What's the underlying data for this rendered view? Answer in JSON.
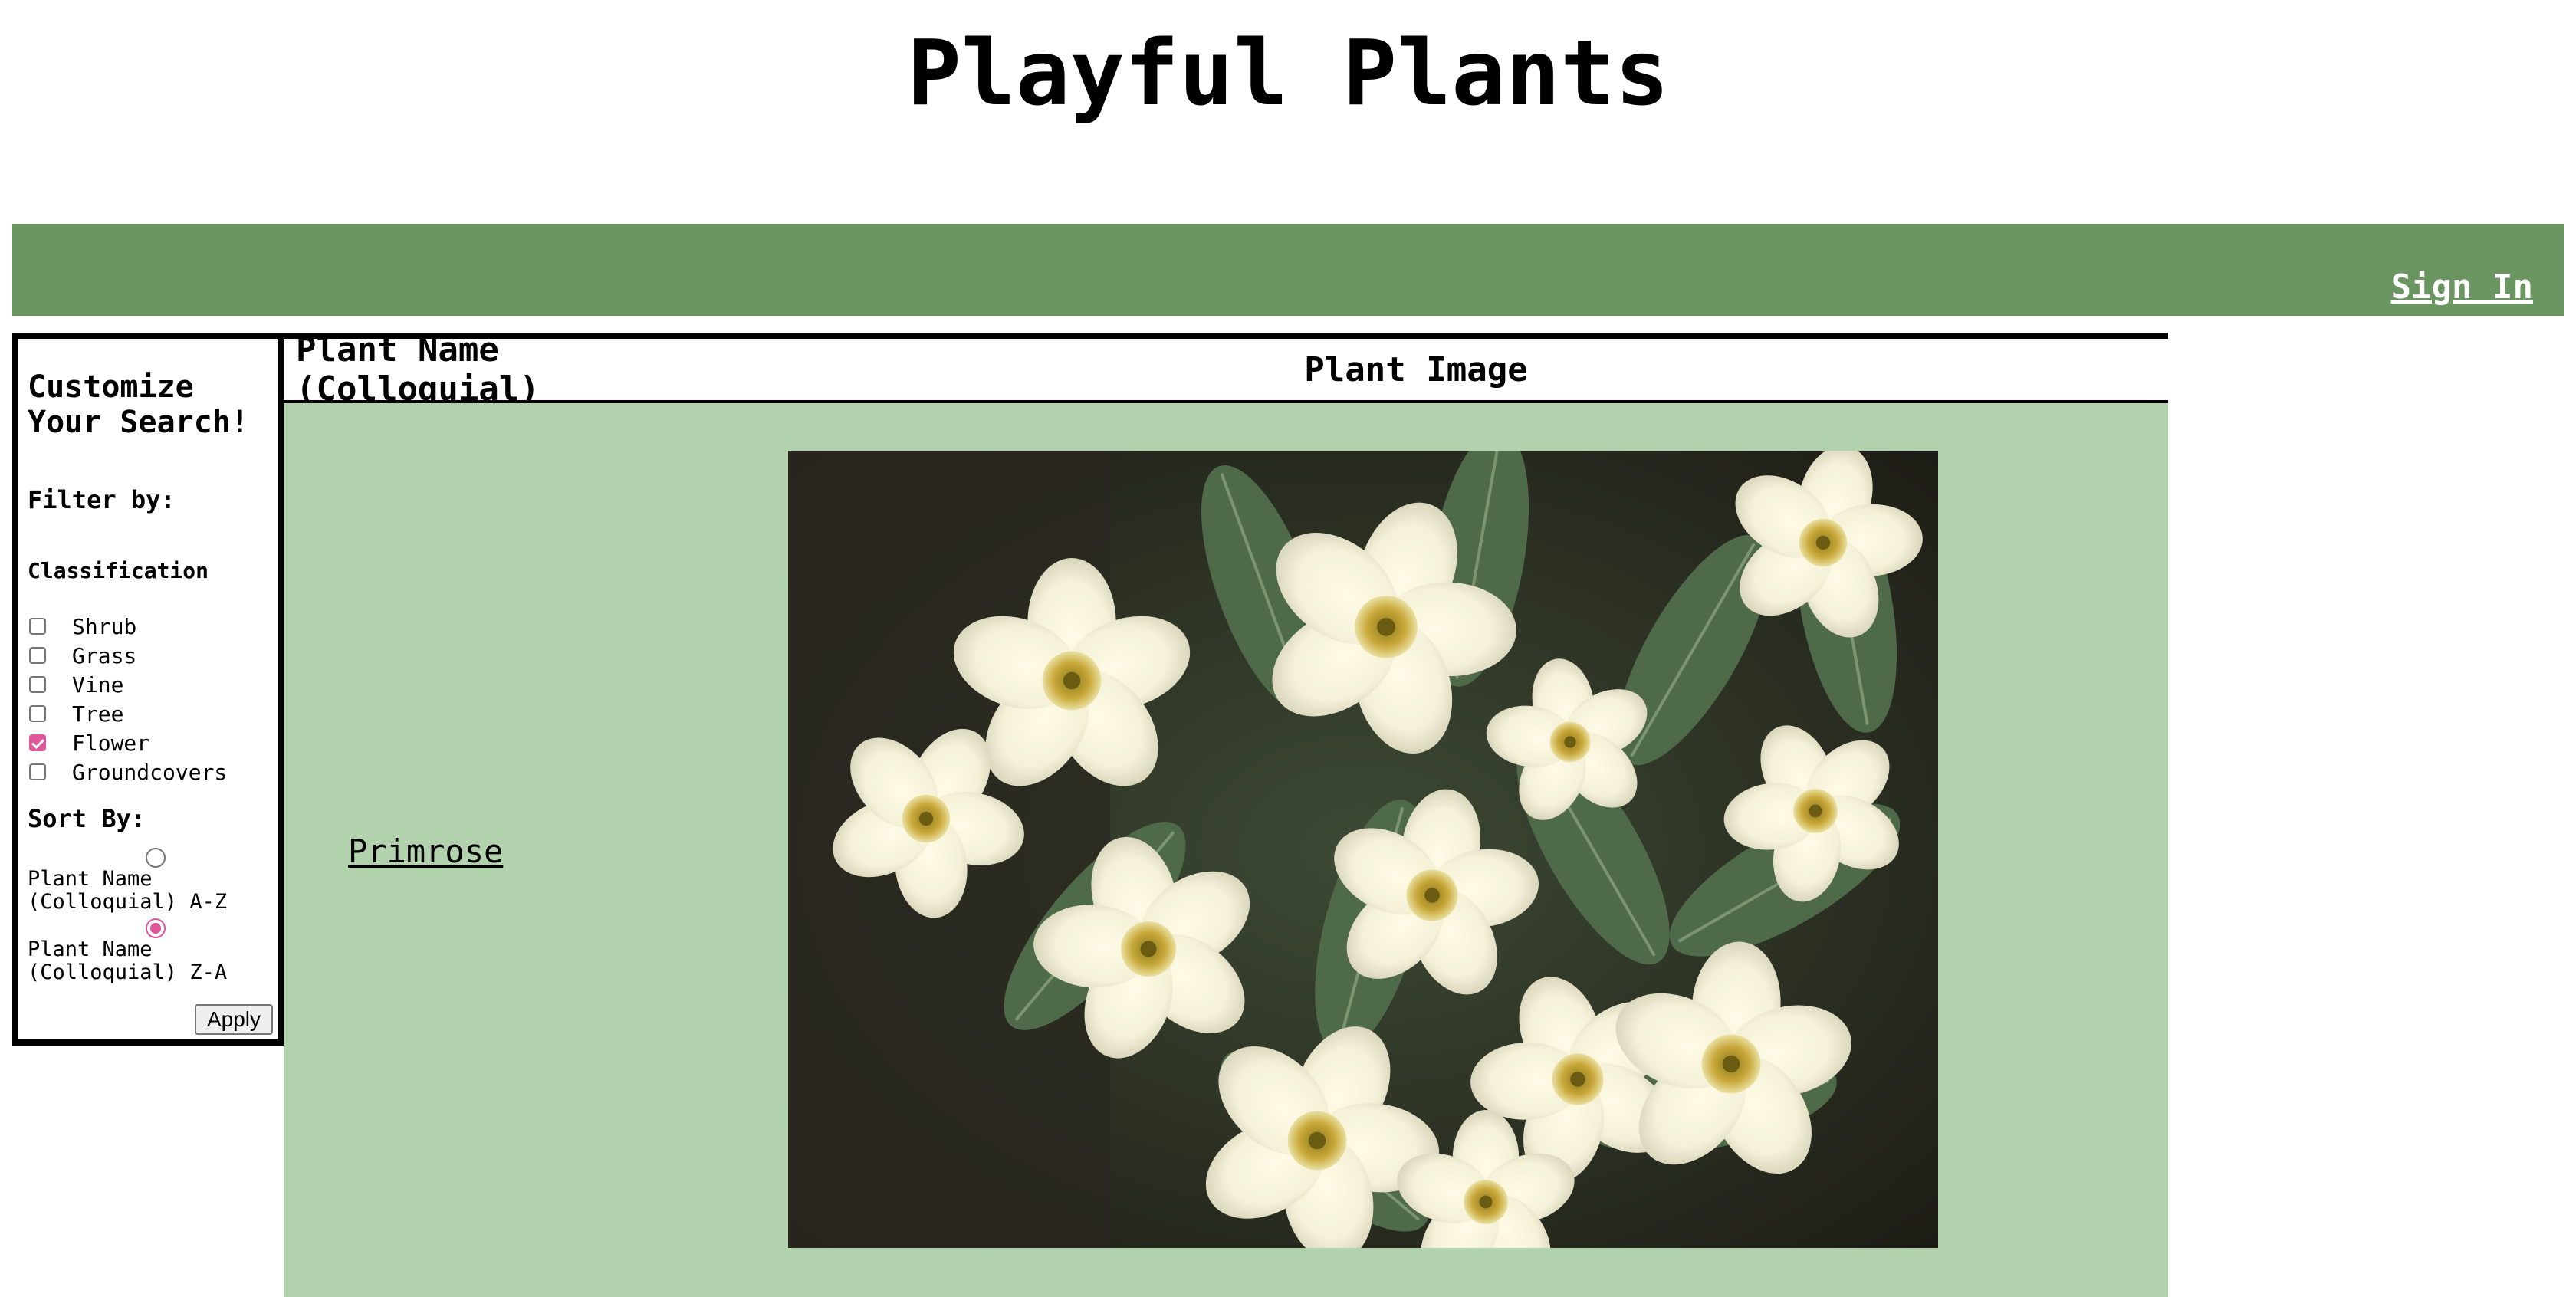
{
  "header": {
    "title": "Playful Plants"
  },
  "nav": {
    "sign_in": "Sign In"
  },
  "sidebar": {
    "heading": "Customize Your Search!",
    "filter_by": "Filter by:",
    "classification_label": "Classification",
    "classifications": [
      {
        "label": "Shrub",
        "checked": false
      },
      {
        "label": "Grass",
        "checked": false
      },
      {
        "label": "Vine",
        "checked": false
      },
      {
        "label": "Tree",
        "checked": false
      },
      {
        "label": "Flower",
        "checked": true
      },
      {
        "label": "Groundcovers",
        "checked": false
      }
    ],
    "sort_by": "Sort By:",
    "sort_options": [
      {
        "label": "Plant Name (Colloquial) A-Z",
        "checked": false
      },
      {
        "label": "Plant Name (Colloquial) Z-A",
        "checked": true
      }
    ],
    "apply_label": "Apply"
  },
  "results": {
    "col_name": "Plant Name (Colloquial)",
    "col_image": "Plant Image",
    "rows": [
      {
        "name": "Primrose",
        "image": "primrose-flowers-photo"
      }
    ]
  },
  "colors": {
    "nav_bg": "#6b9662",
    "row_bg": "#b2d1ad",
    "accent": "#e0569a"
  }
}
